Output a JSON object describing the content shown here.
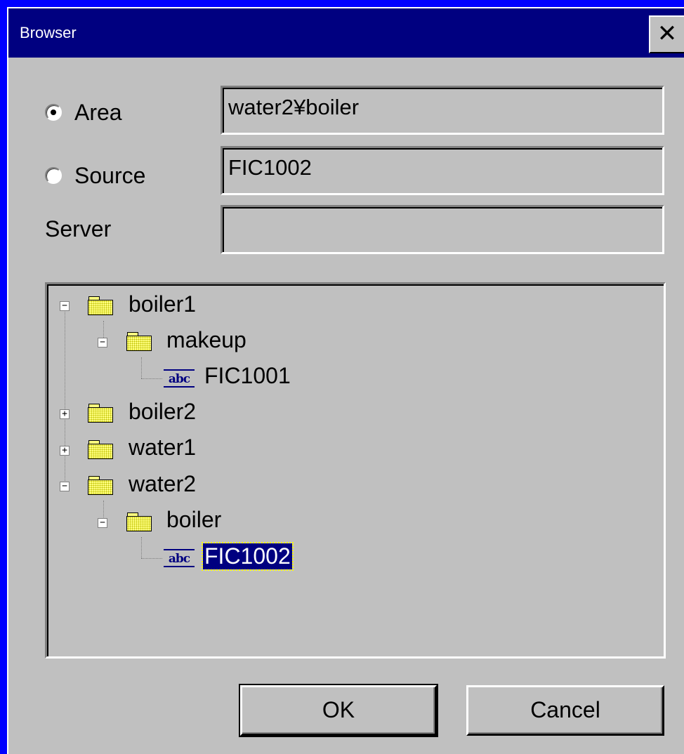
{
  "window": {
    "title": "Browser",
    "close_glyph": "✕"
  },
  "area": {
    "label": "Area",
    "value": "water2¥boiler",
    "checked": true
  },
  "source": {
    "label": "Source",
    "value": "FIC1002",
    "checked": false
  },
  "server": {
    "label": "Server",
    "value": ""
  },
  "tree": {
    "nodes": [
      {
        "label": "boiler1",
        "type": "folder",
        "expanded": true
      },
      {
        "label": "makeup",
        "type": "folder",
        "expanded": true
      },
      {
        "label": "FIC1001",
        "type": "tag",
        "icon_text": "abc"
      },
      {
        "label": "boiler2",
        "type": "folder",
        "expanded": false
      },
      {
        "label": "water1",
        "type": "folder",
        "expanded": false
      },
      {
        "label": "water2",
        "type": "folder",
        "expanded": true
      },
      {
        "label": "boiler",
        "type": "folder",
        "expanded": true
      },
      {
        "label": "FIC1002",
        "type": "tag",
        "icon_text": "abc",
        "selected": true
      }
    ],
    "collapse_glyph": "−",
    "expand_glyph": "+"
  },
  "buttons": {
    "ok_label": "OK",
    "cancel_label": "Cancel"
  },
  "colors": {
    "titlebar": "#000080",
    "desktop": "#0000ff",
    "face": "#c0c0c0",
    "selection": "#000080"
  }
}
